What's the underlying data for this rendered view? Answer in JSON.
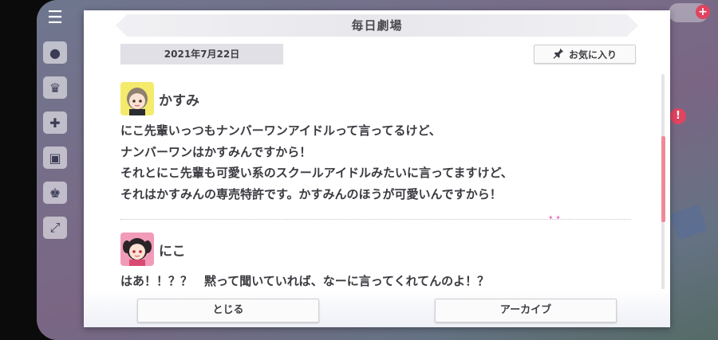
{
  "dialog": {
    "title": "毎日劇場",
    "date": "2021年7月22日",
    "favorite_label": "お気に入り"
  },
  "entries": [
    {
      "speaker": "かすみ",
      "lines": [
        "にこ先輩いっつもナンバーワンアイドルって言ってるけど、",
        "ナンバーワンはかすみんですから！",
        "それとにこ先輩も可愛い系のスクールアイドルみたいに言ってますけど、",
        "それはかすみんの専売特許です。かすみんのほうが可愛いんですから！"
      ]
    },
    {
      "speaker": "にこ",
      "lines": [
        "はあ！！？？　黙って聞いていれば、なーに言ってくれてんのよ！？"
      ]
    }
  ],
  "footer": {
    "close_label": "とじる",
    "archive_label": "アーカイブ"
  },
  "icons": {
    "favorite": "pin-icon",
    "menu": "hamburger-menu-icon"
  },
  "colors": {
    "scrollbar_thumb": "#ee8a98",
    "date_chip": "#e0e0e6",
    "title_bar": "#ececf0"
  },
  "scroll_position": 0.32
}
